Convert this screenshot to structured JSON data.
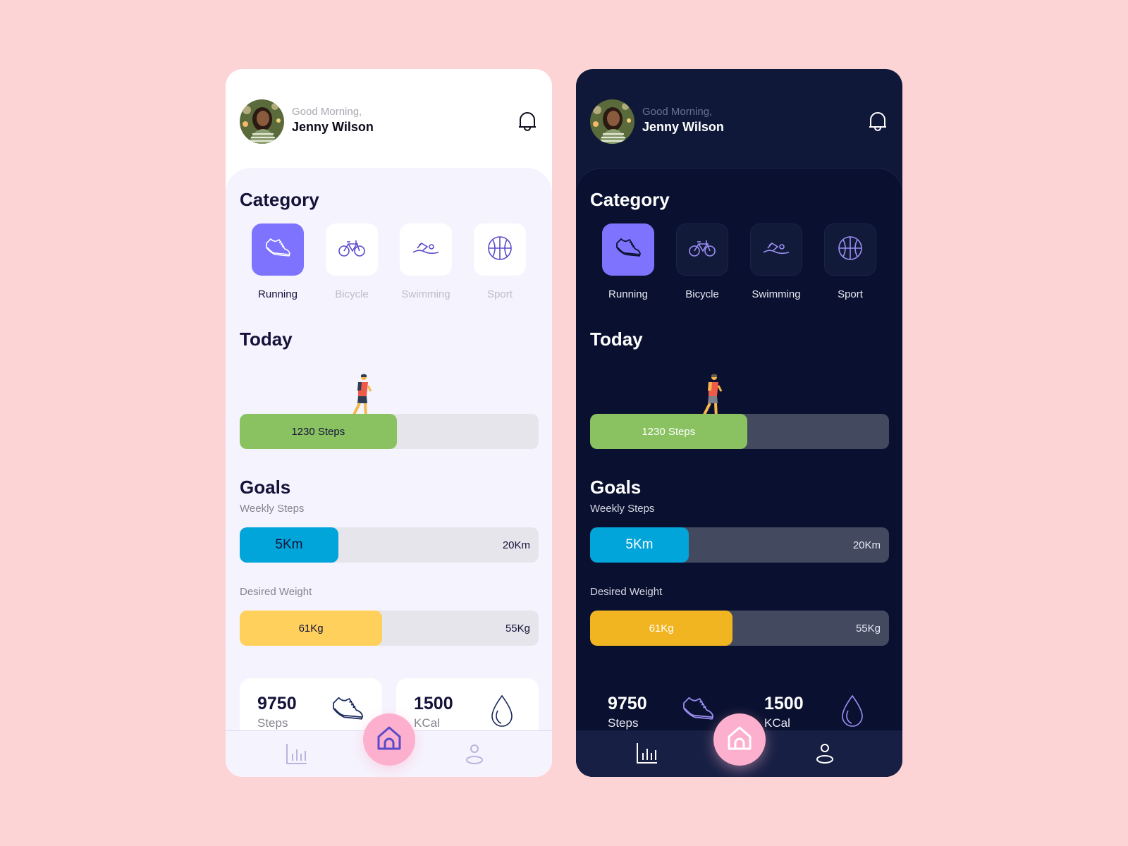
{
  "themes": {
    "light": {
      "header": {
        "greeting": "Good Morning,",
        "name": "Jenny Wilson",
        "notification_icon": "bell-icon"
      },
      "category": {
        "title": "Category",
        "items": [
          {
            "label": "Running",
            "icon": "sneaker-icon",
            "active": true
          },
          {
            "label": "Bicycle",
            "icon": "bicycle-icon",
            "active": false
          },
          {
            "label": "Swimming",
            "icon": "swimmer-icon",
            "active": false
          },
          {
            "label": "Sport",
            "icon": "basketball-icon",
            "active": false
          }
        ]
      },
      "today": {
        "title": "Today",
        "steps_label": "1230 Steps",
        "progress": 0.525,
        "color": "#8ac262"
      },
      "goals": {
        "title": "Goals",
        "weekly": {
          "label": "Weekly Steps",
          "current": "5Km",
          "target": "20Km",
          "progress": 0.33,
          "color": "#01a5d9"
        },
        "weight": {
          "label": "Desired Weight",
          "current": "61Kg",
          "target": "55Kg",
          "progress": 0.477,
          "color": "#ffd05c"
        }
      },
      "stats": [
        {
          "value": "9750",
          "unit": "Steps",
          "icon": "sneaker-icon"
        },
        {
          "value": "1500",
          "unit": "KCal",
          "icon": "water-drop-icon"
        }
      ],
      "nav": {
        "items": [
          "chart-icon",
          "home-icon",
          "profile-icon"
        ],
        "active": "home-icon"
      }
    },
    "dark": {
      "header": {
        "greeting": "Good Morning,",
        "name": "Jenny Wilson",
        "notification_icon": "bell-icon"
      },
      "category": {
        "title": "Category",
        "items": [
          {
            "label": "Running",
            "icon": "sneaker-icon",
            "active": true
          },
          {
            "label": "Bicycle",
            "icon": "bicycle-icon",
            "active": false
          },
          {
            "label": "Swimming",
            "icon": "swimmer-icon",
            "active": false
          },
          {
            "label": "Sport",
            "icon": "basketball-icon",
            "active": false
          }
        ]
      },
      "today": {
        "title": "Today",
        "steps_label": "1230 Steps",
        "progress": 0.525,
        "color": "#8ac262"
      },
      "goals": {
        "title": "Goals",
        "weekly": {
          "label": "Weekly Steps",
          "current": "5Km",
          "target": "20Km",
          "progress": 0.33,
          "color": "#01a5d9"
        },
        "weight": {
          "label": "Desired Weight",
          "current": "61Kg",
          "target": "55Kg",
          "progress": 0.477,
          "color": "#f0b521"
        }
      },
      "stats": [
        {
          "value": "9750",
          "unit": "Steps",
          "icon": "sneaker-icon"
        },
        {
          "value": "1500",
          "unit": "KCal",
          "icon": "water-drop-icon"
        }
      ],
      "nav": {
        "items": [
          "chart-icon",
          "home-icon",
          "profile-icon"
        ],
        "active": "home-icon"
      }
    }
  },
  "colors": {
    "background": "#fdd4d6",
    "accent": "#7e73ff",
    "home_button": "#fdb0cd",
    "light_surface": "#f5f4fe",
    "dark_surface": "#0a1130"
  }
}
